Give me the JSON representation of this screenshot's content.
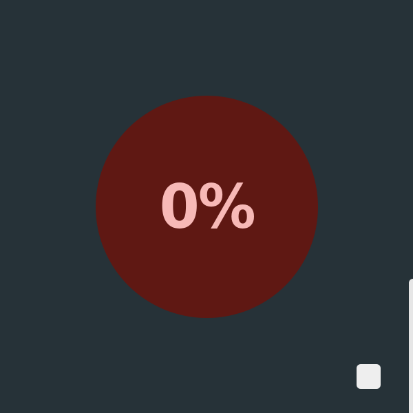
{
  "progress": {
    "label": "0%",
    "value": 0
  },
  "colors": {
    "background": "#263238",
    "circle": "#5f1813",
    "text": "#f7b9b7",
    "button": "#eeeeee"
  }
}
